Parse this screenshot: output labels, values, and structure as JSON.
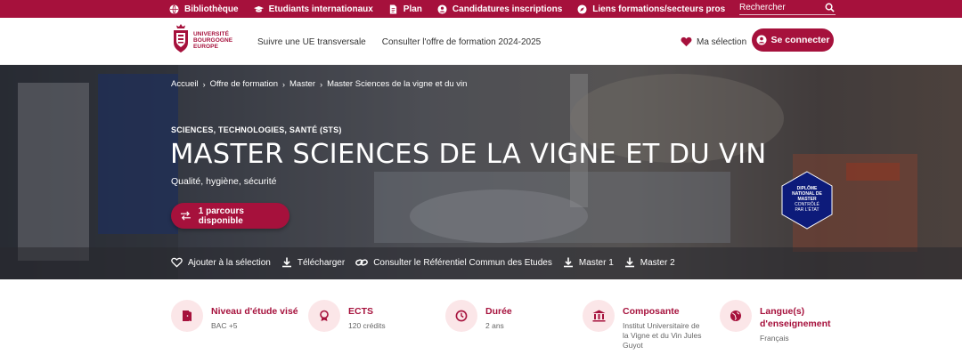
{
  "topbar": {
    "links": [
      {
        "label": "Bibliothèque",
        "icon": "globe-icon"
      },
      {
        "label": "Etudiants internationaux",
        "icon": "graduation-cap-icon"
      },
      {
        "label": "Plan",
        "icon": "document-icon"
      },
      {
        "label": "Candidatures inscriptions",
        "icon": "user-circle-icon"
      },
      {
        "label": "Liens formations/secteurs pros",
        "icon": "compass-icon"
      }
    ],
    "search_placeholder": "Rechercher"
  },
  "header": {
    "logo_lines": [
      "UNIVERSITÉ",
      "BOURGOGNE",
      "EUROPE"
    ],
    "nav": [
      "Suivre une UE transversale",
      "Consulter l'offre de formation 2024-2025"
    ],
    "selection_label": "Ma sélection",
    "connect_label": "Se connecter"
  },
  "hero": {
    "breadcrumb": [
      "Accueil",
      "Offre de formation",
      "Master",
      "Master Sciences de la vigne et du vin"
    ],
    "kicker": "SCIENCES, TECHNOLOGIES, SANTÉ (STS)",
    "title": "MASTER SCIENCES DE LA VIGNE ET DU VIN",
    "subtitle": "Qualité, hygiène, sécurité",
    "parcours_label": "1 parcours disponible",
    "badge_lines": [
      "DIPLÔME",
      "NATIONAL DE",
      "MASTER",
      "CONTRÔLÉ",
      "PAR L'ÉTAT"
    ],
    "actions": [
      {
        "label": "Ajouter à la sélection",
        "icon": "heart-outline-icon"
      },
      {
        "label": "Télécharger",
        "icon": "download-icon"
      },
      {
        "label": "Consulter le Référentiel Commun des Etudes",
        "icon": "link-icon"
      },
      {
        "label": "Master 1",
        "icon": "download-icon"
      },
      {
        "label": "Master 2",
        "icon": "download-icon"
      }
    ]
  },
  "cards": [
    {
      "label": "Niveau d'étude visé",
      "value": "BAC +5",
      "icon": "door-icon"
    },
    {
      "label": "ECTS",
      "value": "120 crédits",
      "icon": "medal-icon"
    },
    {
      "label": "Durée",
      "value": "2 ans",
      "icon": "clock-icon"
    },
    {
      "label": "Composante",
      "value": "Institut Universitaire de la Vigne et du Vin Jules Guyot",
      "icon": "building-icon"
    },
    {
      "label": "Langue(s) d'enseignement",
      "value": "Français",
      "icon": "globe-icon"
    }
  ],
  "colors": {
    "brand": "#a6113c",
    "card_bg": "#fbe6e8"
  }
}
